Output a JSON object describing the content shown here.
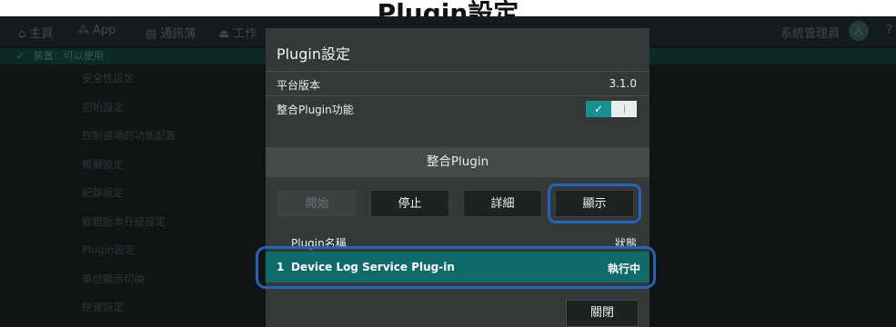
{
  "header": {
    "title": "Plugin設定"
  },
  "topbar": {
    "nav": [
      {
        "label": "主頁",
        "icon": "⌂"
      },
      {
        "label": "App",
        "icon": "⁂"
      },
      {
        "label": "通訊簿",
        "icon": "▤"
      },
      {
        "label": "工作",
        "icon": "⏏"
      }
    ],
    "user": "系統管理員",
    "avatar_icon": "人",
    "help_icon": "?"
  },
  "status": {
    "icon": "✓",
    "text": "裝置：可以使用"
  },
  "menu": {
    "items": [
      "安全性設定",
      "初始設定",
      "控制選項的功能配置",
      "模擬設定",
      "記錄設定",
      "軟體版本升級設定",
      "Plugin設定",
      "單位顯示切換",
      "快速設定"
    ]
  },
  "dialog": {
    "title": "Plugin設定",
    "platform_label": "平台版本",
    "platform_value": "3.1.0",
    "integration_label": "整合Plugin功能",
    "toggle_on_icon": "✓",
    "section_title": "整合Plugin",
    "buttons": {
      "start": "開始",
      "stop": "停止",
      "details": "詳細",
      "display": "顯示"
    },
    "list": {
      "col_name": "Plugin名稱",
      "col_status": "狀態",
      "rows": [
        {
          "index": "1",
          "name": "Device Log Service Plug-in",
          "status": "執行中"
        }
      ]
    },
    "close": "關閉"
  },
  "colors": {
    "accent": "#1a8f8f",
    "highlight": "#2565b8",
    "selected_row": "#0f6a6a"
  }
}
